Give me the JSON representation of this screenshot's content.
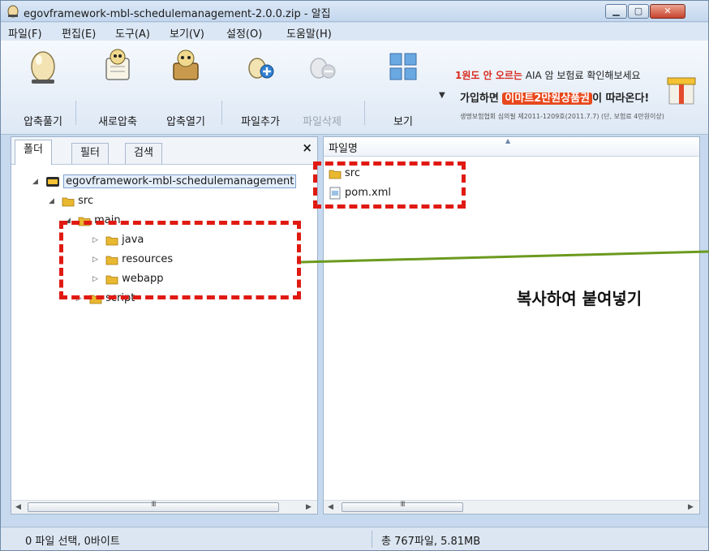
{
  "window": {
    "title": "egovframework-mbl-schedulemanagement-2.0.0.zip - 알집",
    "buttons": {
      "minimize": "▁",
      "maximize": "▢",
      "close": "✕"
    }
  },
  "menu": [
    "파일(F)",
    "편집(E)",
    "도구(A)",
    "보기(V)",
    "설정(O)",
    "도움말(H)"
  ],
  "toolbar": {
    "extract": "압축풀기",
    "new_archive": "새로압축",
    "open_archive": "압축열기",
    "add_files": "파일추가",
    "delete_files": "파일삭제",
    "view": "보기",
    "view_dropdown": "▼"
  },
  "ad": {
    "line1_prefix": "1원도 안 오르는",
    "line1_rest": " AIA 암 보험료 확인해보세요",
    "line2_prefix": "가입하면 ",
    "line2_highlight": "이마트2만원상품권",
    "line2_suffix": "이 따라온다!",
    "line3": "생명보험협회 심의필 제2011-1209호(2011.7.7) (단, 보험료 4만원이상)"
  },
  "left_pane": {
    "tabs": [
      "폴더",
      "필터",
      "검색"
    ],
    "close": "×",
    "tree": [
      {
        "label": "egovframework-mbl-schedulemanagement",
        "kind": "zip",
        "expander": "◢"
      },
      {
        "label": "src",
        "kind": "folder",
        "expander": "◢"
      },
      {
        "label": "main",
        "kind": "folder",
        "expander": "◢"
      },
      {
        "label": "java",
        "kind": "folder",
        "expander": "▷"
      },
      {
        "label": "resources",
        "kind": "folder",
        "expander": "▷"
      },
      {
        "label": "webapp",
        "kind": "folder",
        "expander": "▷"
      },
      {
        "label": "script",
        "kind": "folder",
        "expander": "▷"
      }
    ],
    "scroll_grip": "III",
    "scroll_left": "◀",
    "scroll_right": "▶"
  },
  "right_pane": {
    "column_header": "파일명",
    "sort_indicator": "▲",
    "files": [
      {
        "name": "src",
        "kind": "folder"
      },
      {
        "name": "pom.xml",
        "kind": "file"
      }
    ],
    "scroll_grip": "III",
    "scroll_left": "◀",
    "scroll_right": "▶"
  },
  "status": {
    "selection": "0 파일 선택,  0바이트",
    "total": "총 767파일,  5.81MB"
  },
  "annotation": {
    "label": "복사하여 붙여넣기",
    "box_color": "#e01a12",
    "line_color": "#6b9a1e"
  },
  "colors": {
    "folder": "#e8b830",
    "title_bar": "#c4d7ee",
    "close_button": "#c7442d"
  }
}
